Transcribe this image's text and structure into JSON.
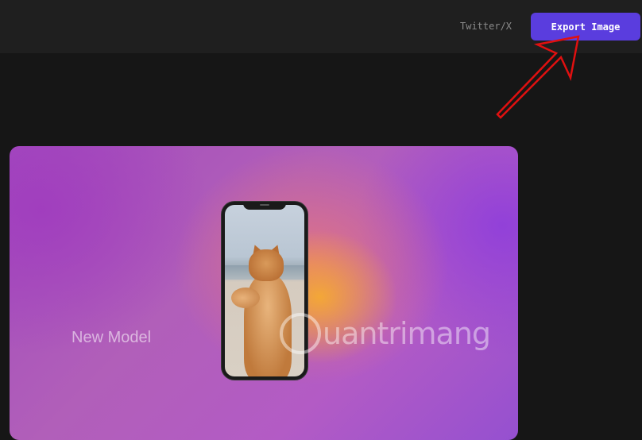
{
  "header": {
    "platform_label": "Twitter/X",
    "export_label": "Export Image",
    "accent_color": "#5a3dde"
  },
  "canvas": {
    "model_label": "New Model",
    "device": "phone-mockup",
    "watermark_text": "uantrimang"
  },
  "annotation": {
    "arrow_color": "#e01010",
    "icon": "red-arrow-icon"
  }
}
